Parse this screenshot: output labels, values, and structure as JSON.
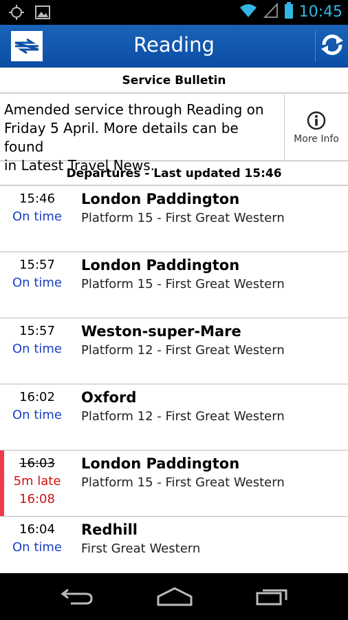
{
  "statusbar": {
    "time": "10:45",
    "icons": [
      "gps-icon",
      "image-icon",
      "wifi-icon",
      "signal-icon",
      "battery-icon"
    ]
  },
  "actionbar": {
    "title": "Reading",
    "logo": "national-rail-logo",
    "refresh_icon": "refresh-icon",
    "colors": {
      "bar": "#1a63b8"
    }
  },
  "bulletin": {
    "header": "Service Bulletin",
    "lines": [
      "Amended service through Reading on",
      "Friday 5 April. More details can be found",
      "in Latest Travel News."
    ],
    "more_info_label": "More Info"
  },
  "departures": {
    "header": "Departures - Last updated 15:46",
    "rows": [
      {
        "scheduled": "15:46",
        "status": "On time",
        "expected": "",
        "destination": "London Paddington",
        "detail": "Platform 15 - First Great Western",
        "late": false
      },
      {
        "scheduled": "15:57",
        "status": "On time",
        "expected": "",
        "destination": "London Paddington",
        "detail": "Platform 15 - First Great Western",
        "late": false
      },
      {
        "scheduled": "15:57",
        "status": "On time",
        "expected": "",
        "destination": "Weston-super-Mare",
        "detail": "Platform 12 - First Great Western",
        "late": false
      },
      {
        "scheduled": "16:02",
        "status": "On time",
        "expected": "",
        "destination": "Oxford",
        "detail": "Platform 12 - First Great Western",
        "late": false
      },
      {
        "scheduled": "16:03",
        "status": "5m late",
        "expected": "16:08",
        "destination": "London Paddington",
        "detail": "Platform 15 - First Great Western",
        "late": true
      },
      {
        "scheduled": "16:04",
        "status": "On time",
        "expected": "",
        "destination": "Redhill",
        "detail": "First Great Western",
        "late": false
      }
    ]
  },
  "navbar": {
    "icons": [
      "back-icon",
      "home-icon",
      "recent-apps-icon"
    ]
  }
}
